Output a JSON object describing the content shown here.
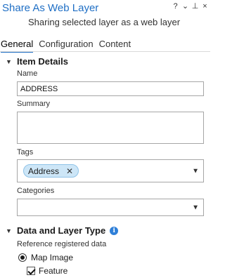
{
  "pane": {
    "title": "Share As Web Layer",
    "subtitle": "Sharing selected layer as a web layer",
    "controls": {
      "help": "?",
      "menu": "⌄",
      "pin": "📌",
      "close": "×"
    }
  },
  "tabs": [
    {
      "label": "General",
      "active": true
    },
    {
      "label": "Configuration",
      "active": false
    },
    {
      "label": "Content",
      "active": false
    }
  ],
  "item_details": {
    "heading": "Item Details",
    "name_label": "Name",
    "name_value": "ADDRESS",
    "summary_label": "Summary",
    "summary_value": "",
    "tags_label": "Tags",
    "tags": [
      "Address"
    ],
    "categories_label": "Categories",
    "categories_value": ""
  },
  "data_layer_type": {
    "heading": "Data and Layer Type",
    "reference_label": "Reference registered data",
    "map_image_label": "Map Image",
    "map_image_selected": true,
    "feature_label": "Feature",
    "feature_checked": true
  },
  "colors": {
    "accent": "#1f6fc5",
    "tag_bg": "#cde6f7",
    "info_icon": "#2f7fd8"
  }
}
